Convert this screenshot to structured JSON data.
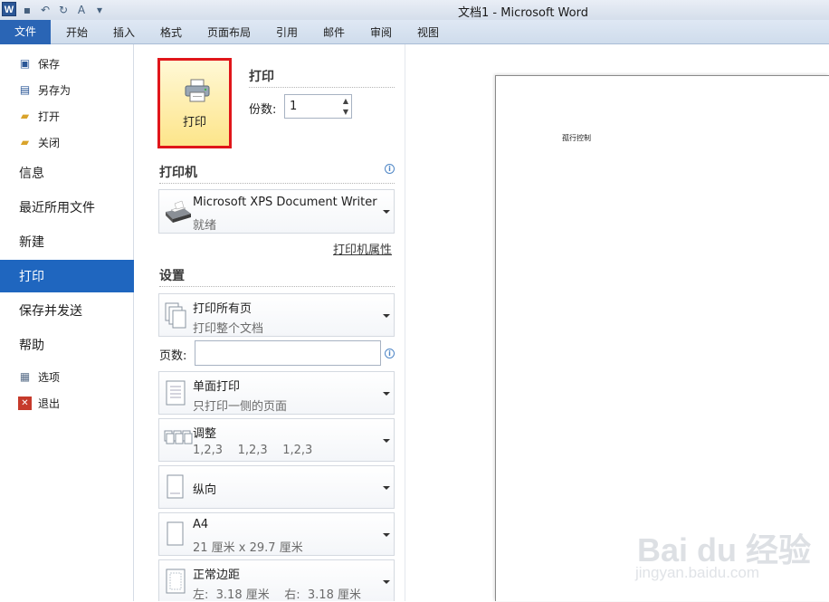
{
  "window": {
    "title": "文档1 - Microsoft Word"
  },
  "ribbon": {
    "file_tab": "文件",
    "tabs": [
      "开始",
      "插入",
      "格式",
      "页面布局",
      "引用",
      "邮件",
      "审阅",
      "视图"
    ]
  },
  "nav": {
    "small_top": [
      {
        "label": "保存",
        "icon": "save-icon"
      },
      {
        "label": "另存为",
        "icon": "save-as-icon"
      },
      {
        "label": "打开",
        "icon": "open-folder-icon"
      },
      {
        "label": "关闭",
        "icon": "close-folder-icon"
      }
    ],
    "big": [
      {
        "label": "信息"
      },
      {
        "label": "最近所用文件"
      },
      {
        "label": "新建"
      },
      {
        "label": "打印",
        "active": true
      },
      {
        "label": "保存并发送"
      },
      {
        "label": "帮助"
      }
    ],
    "small_bottom": [
      {
        "label": "选项",
        "icon": "options-icon"
      },
      {
        "label": "退出",
        "icon": "exit-icon"
      }
    ]
  },
  "print": {
    "button_label": "打印",
    "section_title": "打印",
    "copies_label": "份数:",
    "copies_value": "1"
  },
  "printer": {
    "section_title": "打印机",
    "name": "Microsoft XPS Document Writer",
    "status": "就绪",
    "properties_link": "打印机属性"
  },
  "settings": {
    "section_title": "设置",
    "pages_label": "页数:",
    "pages_value": "",
    "items": [
      {
        "main": "打印所有页",
        "sub": "打印整个文档",
        "icon": "pages-icon"
      },
      {
        "main": "单面打印",
        "sub": "只打印一侧的页面",
        "icon": "one-sided-icon"
      },
      {
        "main": "调整",
        "sub": "1,2,3    1,2,3    1,2,3",
        "icon": "collate-icon"
      },
      {
        "main": "纵向",
        "sub": "",
        "icon": "portrait-icon"
      },
      {
        "main": "A4",
        "sub": "21 厘米 x 29.7 厘米",
        "icon": "paper-size-icon"
      },
      {
        "main": "正常边距",
        "sub": "左:  3.18 厘米    右:  3.18 厘米",
        "icon": "margins-icon"
      }
    ]
  },
  "preview": {
    "page_text": "孤行控制"
  },
  "watermark": {
    "logo": "Bai du 经验",
    "url": "jingyan.baidu.com"
  },
  "colors": {
    "accent": "#1f66bf",
    "print_highlight": "#e0161a",
    "button_fill": "#fde58a"
  }
}
